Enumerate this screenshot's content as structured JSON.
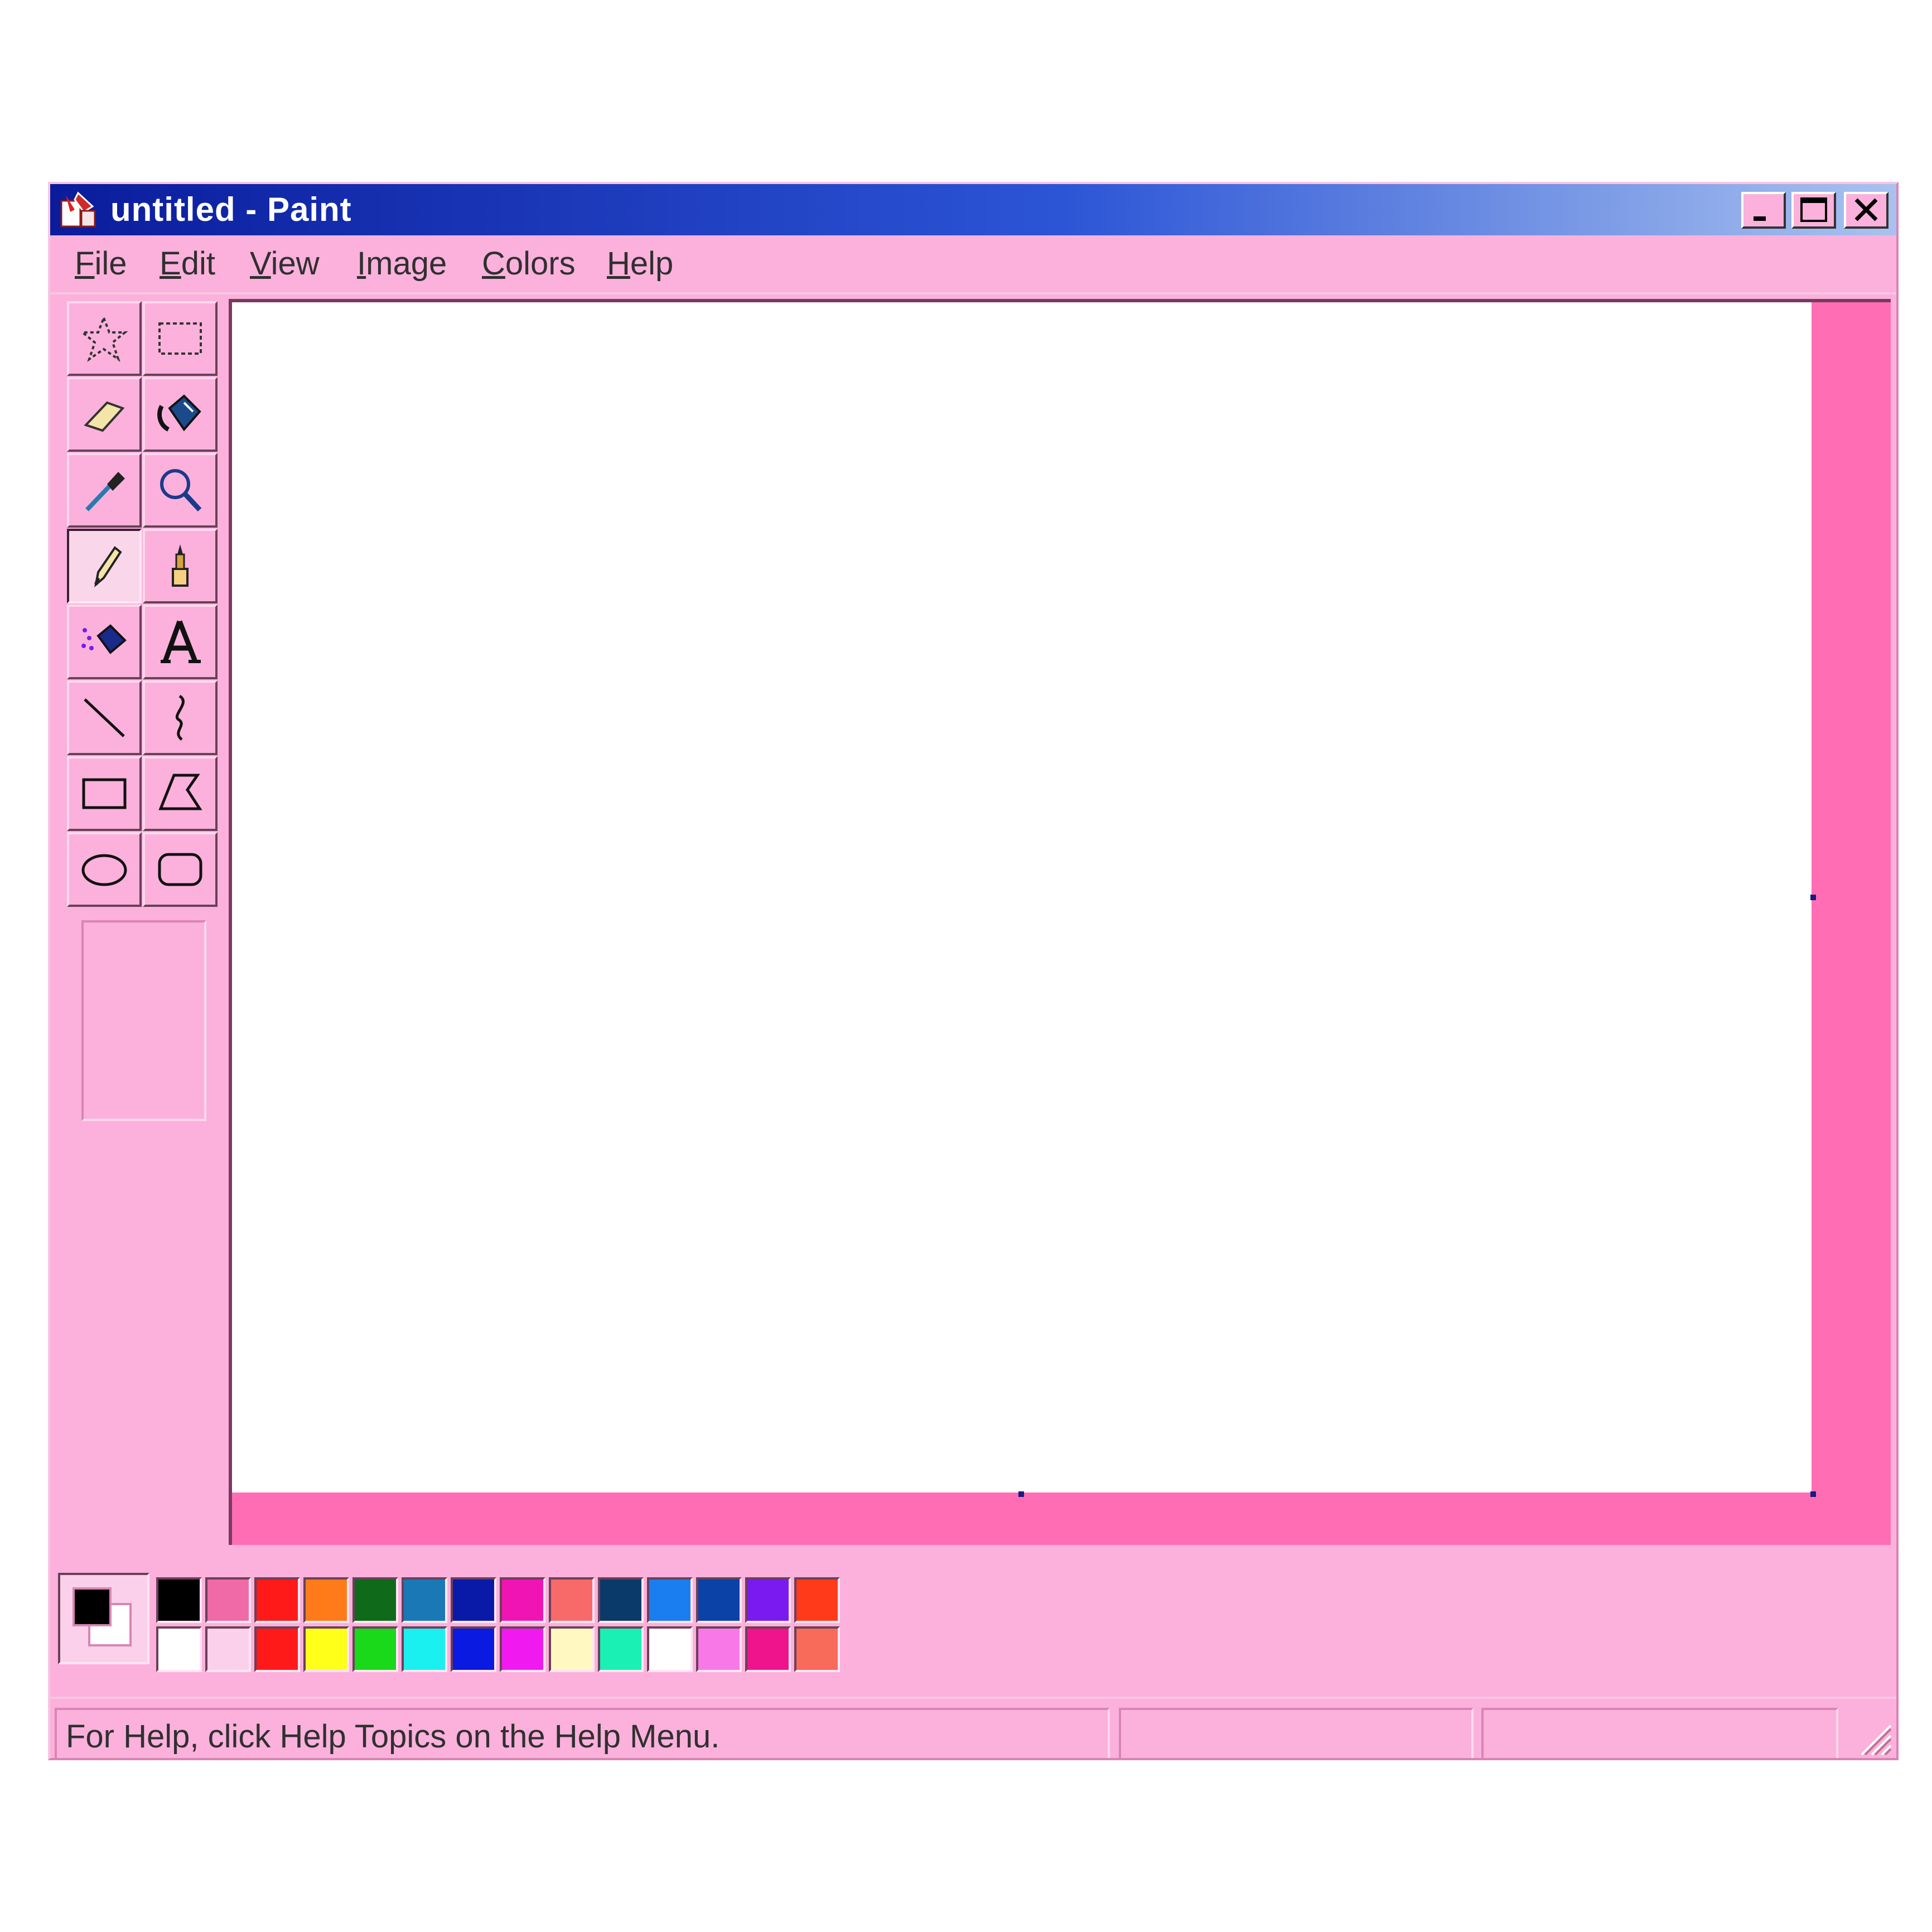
{
  "window": {
    "title": "untitled - Paint",
    "app_icon": "paint-icon",
    "titlebar_gradient": [
      "#0a1c9c",
      "#a9c2ef"
    ],
    "controls": [
      "minimize-icon",
      "maximize-icon",
      "close-icon"
    ]
  },
  "menu": {
    "items": [
      {
        "mnemonic": "F",
        "rest": "ile"
      },
      {
        "mnemonic": "E",
        "rest": "dit"
      },
      {
        "mnemonic": "V",
        "rest": "iew"
      },
      {
        "mnemonic": "I",
        "rest": "mage"
      },
      {
        "mnemonic": "C",
        "rest": "olors"
      },
      {
        "mnemonic": "H",
        "rest": "elp"
      }
    ]
  },
  "tools": [
    {
      "name": "free-form-select-icon"
    },
    {
      "name": "rect-select-icon"
    },
    {
      "name": "eraser-icon"
    },
    {
      "name": "fill-bucket-icon"
    },
    {
      "name": "color-picker-icon"
    },
    {
      "name": "magnifier-icon"
    },
    {
      "name": "pencil-icon",
      "active": true
    },
    {
      "name": "brush-icon"
    },
    {
      "name": "airbrush-icon"
    },
    {
      "name": "text-tool-icon",
      "glyph": "A"
    },
    {
      "name": "line-icon"
    },
    {
      "name": "curve-icon"
    },
    {
      "name": "rectangle-icon"
    },
    {
      "name": "polygon-icon"
    },
    {
      "name": "ellipse-icon"
    },
    {
      "name": "rounded-rect-icon"
    }
  ],
  "colors": {
    "background": "#fbb1dc",
    "workspace": "#ff6eb5",
    "foreground_color": "#000000",
    "background_color": "#ffffff",
    "palette_top": [
      "#000000",
      "#f06aa8",
      "#ff1a1a",
      "#ff7b1a",
      "#0f6a1a",
      "#1a78b6",
      "#0a1aa8",
      "#f014b4",
      "#f86a6a",
      "#0a3a6a",
      "#1a7df0",
      "#0a42a8",
      "#7a1af0",
      "#ff3a1a"
    ],
    "palette_bottom": [
      "#ffffff",
      "#fbd0ea",
      "#ff1a1a",
      "#ffff1a",
      "#1ad81a",
      "#1af0f0",
      "#0a1ae0",
      "#f01af0",
      "#fff8c0",
      "#1af0b4",
      "#ffffff",
      "#f878e8",
      "#f0148c",
      "#f86a5a"
    ]
  },
  "status": {
    "help_text": "For Help, click Help Topics on the Help Menu."
  }
}
